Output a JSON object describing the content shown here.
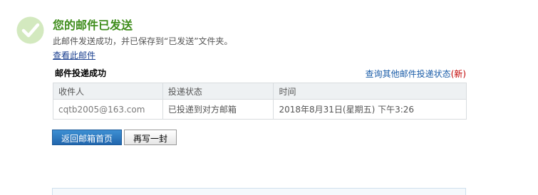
{
  "header": {
    "title": "您的邮件已发送",
    "subtitle": "此邮件发送成功，并已保存到“已发送”文件夹。",
    "view_link": "查看此邮件"
  },
  "section": {
    "title": "邮件投递成功",
    "query_link_text": "查询其他邮件投递状态",
    "query_link_open": "(",
    "query_link_tag": "新",
    "query_link_close": ")"
  },
  "table": {
    "headers": [
      "收件人",
      "投递状态",
      "时间"
    ],
    "rows": [
      [
        "cqtb2005@163.com",
        "已投递到对方邮箱",
        "2018年8月31日(星期五) 下午3:26"
      ]
    ]
  },
  "buttons": {
    "primary": "返回邮箱首页",
    "secondary": "再写一封"
  },
  "icons": {
    "success": "check-circle-icon"
  },
  "colors": {
    "title": "#3f8d1c",
    "check_circle": "#cde6b8",
    "primary_button": "#2a79c2",
    "link": "#1a5ca8",
    "new_tag": "#c00000"
  }
}
